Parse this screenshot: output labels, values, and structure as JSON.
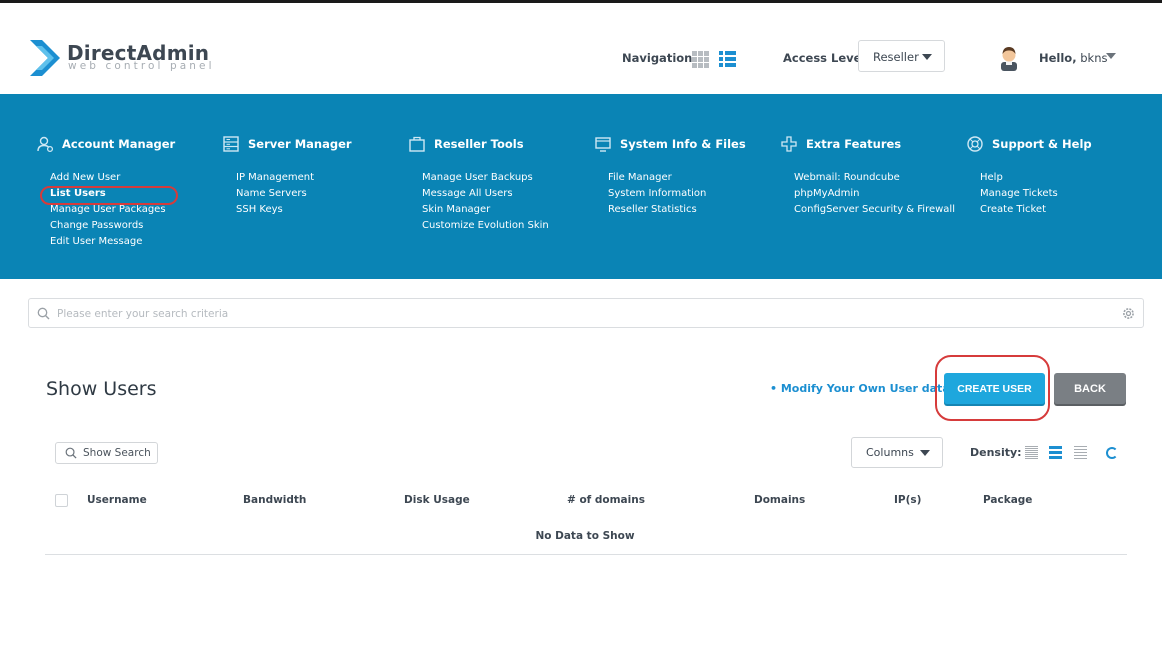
{
  "header": {
    "brand": "DirectAdmin",
    "brand_sub": "web control panel",
    "navigation_label": "Navigation",
    "access_level_label": "Access Level",
    "access_level_value": "Reseller",
    "hello_prefix": "Hello,",
    "username": "bkns"
  },
  "menu": [
    {
      "title": "Account Manager",
      "icon": "user-settings-icon",
      "items": [
        "Add New User",
        "List Users",
        "Manage User Packages",
        "Change Passwords",
        "Edit User Message"
      ]
    },
    {
      "title": "Server Manager",
      "icon": "server-icon",
      "items": [
        "IP Management",
        "Name Servers",
        "SSH Keys"
      ]
    },
    {
      "title": "Reseller Tools",
      "icon": "briefcase-icon",
      "items": [
        "Manage User Backups",
        "Message All Users",
        "Skin Manager",
        "Customize Evolution Skin"
      ]
    },
    {
      "title": "System Info & Files",
      "icon": "monitor-icon",
      "items": [
        "File Manager",
        "System Information",
        "Reseller Statistics"
      ]
    },
    {
      "title": "Extra Features",
      "icon": "plus-icon",
      "items": [
        "Webmail: Roundcube",
        "phpMyAdmin",
        "ConfigServer Security & Firewall"
      ]
    },
    {
      "title": "Support & Help",
      "icon": "lifebuoy-icon",
      "items": [
        "Help",
        "Manage Tickets",
        "Create Ticket"
      ]
    }
  ],
  "search": {
    "placeholder": "Please enter your search criteria"
  },
  "page": {
    "title": "Show Users",
    "modify_link": "• Modify Your Own User data",
    "create_button": "CREATE USER",
    "back_button": "BACK"
  },
  "toolbar": {
    "show_search": "Show Search",
    "columns": "Columns",
    "density_label": "Density:"
  },
  "table": {
    "columns": [
      "Username",
      "Bandwidth",
      "Disk Usage",
      "# of domains",
      "Domains",
      "IP(s)",
      "Package"
    ],
    "empty_text": "No Data to Show"
  },
  "colors": {
    "brand_blue": "#0a84b5",
    "accent": "#1ea7dd",
    "highlight_red": "#d63b3b"
  }
}
